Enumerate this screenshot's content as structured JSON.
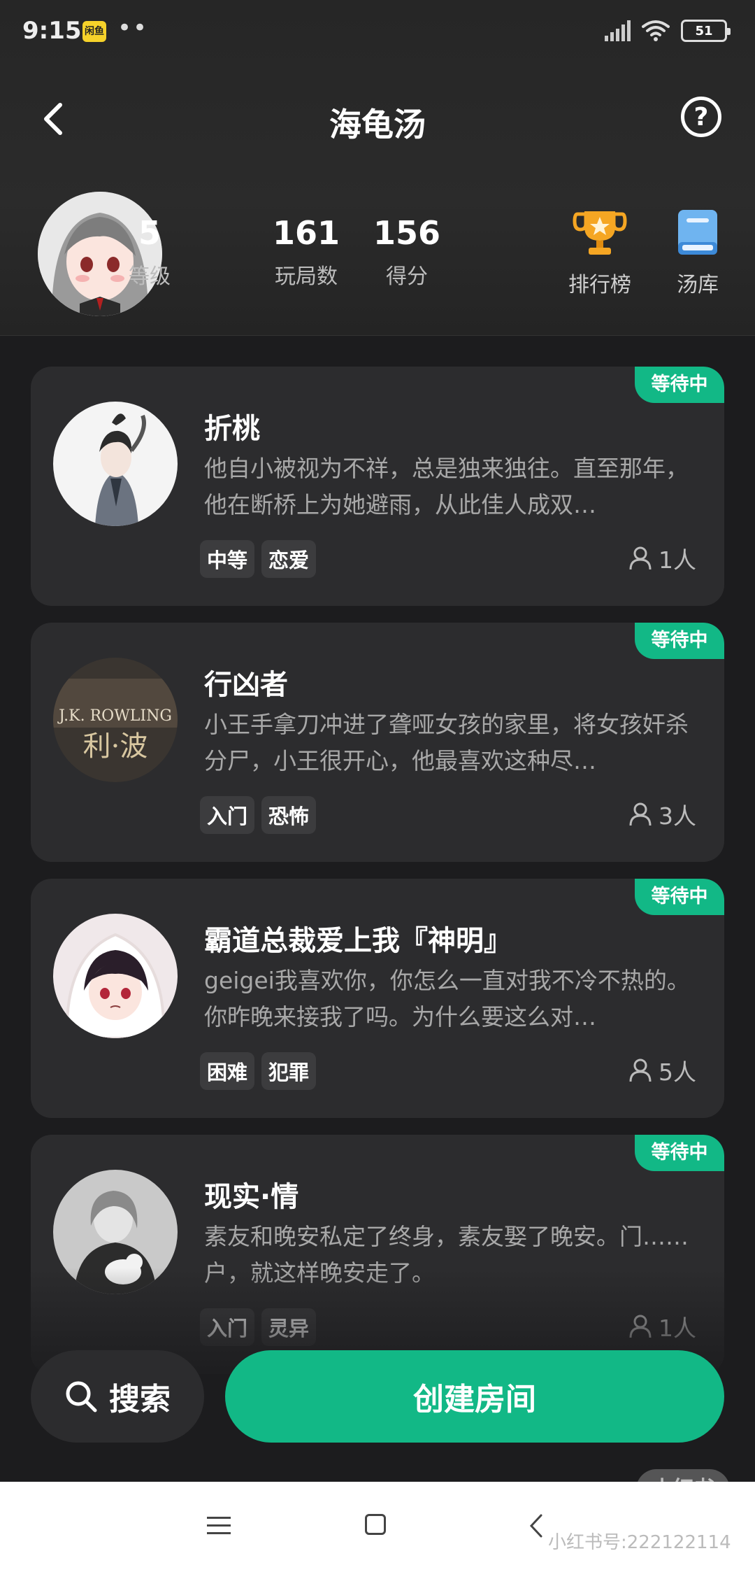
{
  "status_bar": {
    "time": "9:15",
    "app_badge": "闲鱼",
    "dots": "••",
    "battery": "51"
  },
  "header": {
    "title": "海龟汤"
  },
  "profile": {
    "stats": [
      {
        "value": "5",
        "label": "等级"
      },
      {
        "value": "161",
        "label": "玩局数"
      },
      {
        "value": "156",
        "label": "得分"
      }
    ],
    "shortcuts": [
      {
        "label": "排行榜",
        "icon": "trophy-icon"
      },
      {
        "label": "汤库",
        "icon": "book-icon"
      }
    ]
  },
  "rooms": [
    {
      "status": "等待中",
      "title": "折桃",
      "description": "他自小被视为不祥，总是独来独往。直至那年，他在断桥上为她避雨，从此佳人成双…",
      "tags": [
        "中等",
        "恋爱"
      ],
      "players": "1人"
    },
    {
      "status": "等待中",
      "title": "行凶者",
      "description": "小王手拿刀冲进了聋哑女孩的家里，将女孩奸杀分尸，小王很开心，他最喜欢这种尽…",
      "tags": [
        "入门",
        "恐怖"
      ],
      "players": "3人",
      "cover_text_top": "J.K. ROWLING",
      "cover_text_bottom": "利·波"
    },
    {
      "status": "等待中",
      "title": "霸道总裁爱上我『神明』",
      "description": "geigei我喜欢你，你怎么一直对我不冷不热的。你昨晚来接我了吗。为什么要这么对…",
      "tags": [
        "困难",
        "犯罪"
      ],
      "players": "5人"
    },
    {
      "status": "等待中",
      "title": "现实·情",
      "description": "素友和晚安私定了终身，素友娶了晚安。门……户，就这样晚安走了。",
      "tags": [
        "入门",
        "灵异"
      ],
      "players": "1人"
    }
  ],
  "actions": {
    "search_label": "搜索",
    "create_label": "创建房间"
  },
  "watermark": {
    "logo": "小红书",
    "id": "小红书号:222122114"
  },
  "colors": {
    "accent": "#12b886",
    "background": "#1c1c1e",
    "card": "#2c2c2e"
  }
}
